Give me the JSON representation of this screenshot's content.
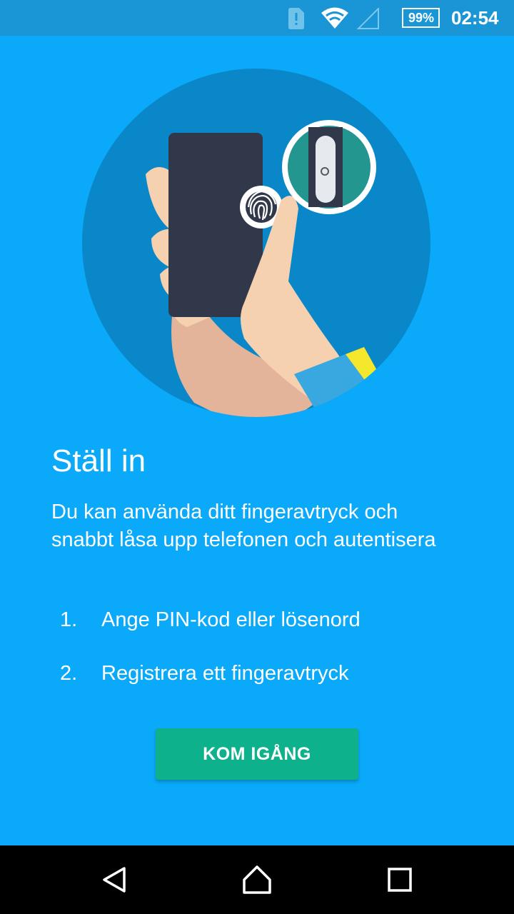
{
  "status_bar": {
    "time": "02:54",
    "battery_text": "99%",
    "icons": [
      "sim-alert-icon",
      "wifi-icon",
      "signal-icon",
      "battery-icon"
    ]
  },
  "illustration": {
    "description_icon": "hand-holding-phone-fingerprint-illustration"
  },
  "content": {
    "title": "Ställ in",
    "description": "Du kan använda ditt fingeravtryck och snabbt låsa upp telefonen och autentisera",
    "steps": [
      {
        "number": "1.",
        "text": "Ange PIN-kod eller lösenord"
      },
      {
        "number": "2.",
        "text": "Registrera ett fingeravtryck"
      }
    ],
    "button_label": "KOM IGÅNG"
  },
  "nav_bar": {
    "icons": [
      "back-icon",
      "home-icon",
      "recents-icon"
    ]
  },
  "colors": {
    "background": "#0aa9f9",
    "status_bar": "#1a96d6",
    "circle": "#0a87c9",
    "button": "#0db18c",
    "nav_bar": "#000000"
  }
}
